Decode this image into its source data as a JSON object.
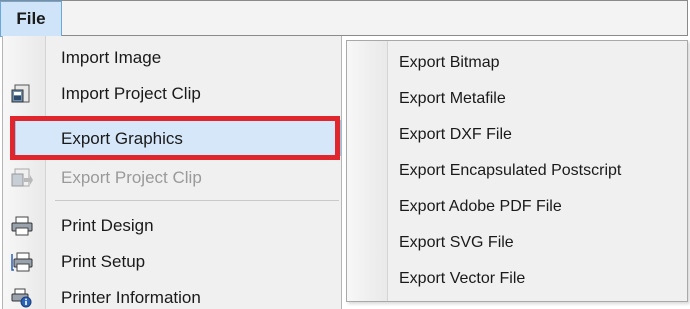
{
  "menubar": {
    "file_label": "File"
  },
  "menu": {
    "items": [
      {
        "label": "Import Image",
        "icon": "none"
      },
      {
        "label": "Import Project Clip",
        "icon": "import-project-clip-icon"
      },
      {
        "label": "Export Graphics",
        "icon": "none",
        "state": "selected-highlighted"
      },
      {
        "label": "Export Project Clip",
        "icon": "export-project-clip-icon",
        "state": "disabled"
      },
      {
        "label": "Print Design",
        "icon": "printer-icon"
      },
      {
        "label": "Print Setup",
        "icon": "print-setup-icon"
      },
      {
        "label": "Printer Information",
        "icon": "printer-info-icon"
      }
    ]
  },
  "submenu": {
    "items": [
      {
        "label": "Export Bitmap"
      },
      {
        "label": "Export Metafile"
      },
      {
        "label": "Export DXF File"
      },
      {
        "label": "Export Encapsulated Postscript"
      },
      {
        "label": "Export Adobe PDF File"
      },
      {
        "label": "Export SVG File"
      },
      {
        "label": "Export Vector File"
      }
    ]
  },
  "colors": {
    "highlight_border": "#e0262c",
    "selected_background": "#d5e7f8",
    "file_menu_active": "#cfe4f8"
  }
}
